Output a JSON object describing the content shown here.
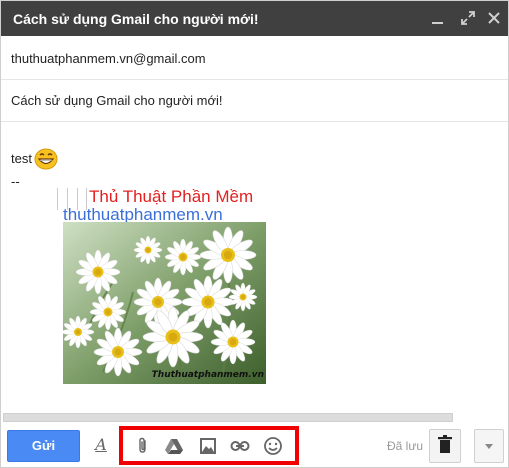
{
  "window": {
    "title": "Cách sử dụng Gmail cho người mới!"
  },
  "recipients": {
    "to": "thuthuatphanmem.vn@gmail.com"
  },
  "subject": {
    "value": "Cách sử dụng Gmail cho người mới!"
  },
  "body": {
    "line1": "test",
    "emoji": "grinning-face-emoji",
    "line2": "--",
    "signature_title": "Thủ Thuật Phần Mềm",
    "signature_link": "thuthuatphanmem.vn",
    "image_watermark": "Thuthuatphanmem.vn"
  },
  "toolbar": {
    "send_label": "Gửi",
    "format_label": "A",
    "saved_label": "Đã lưu",
    "icons": [
      "formatting-icon",
      "attach-icon",
      "drive-icon",
      "insert-photo-icon",
      "insert-link-icon",
      "insert-emoji-icon",
      "trash-icon",
      "more-options-icon"
    ]
  },
  "colors": {
    "titlebar": "#404040",
    "send_button": "#4a8af4",
    "signature_title": "#e22020",
    "signature_link": "#3a6fd8",
    "highlight": "#f00000"
  }
}
